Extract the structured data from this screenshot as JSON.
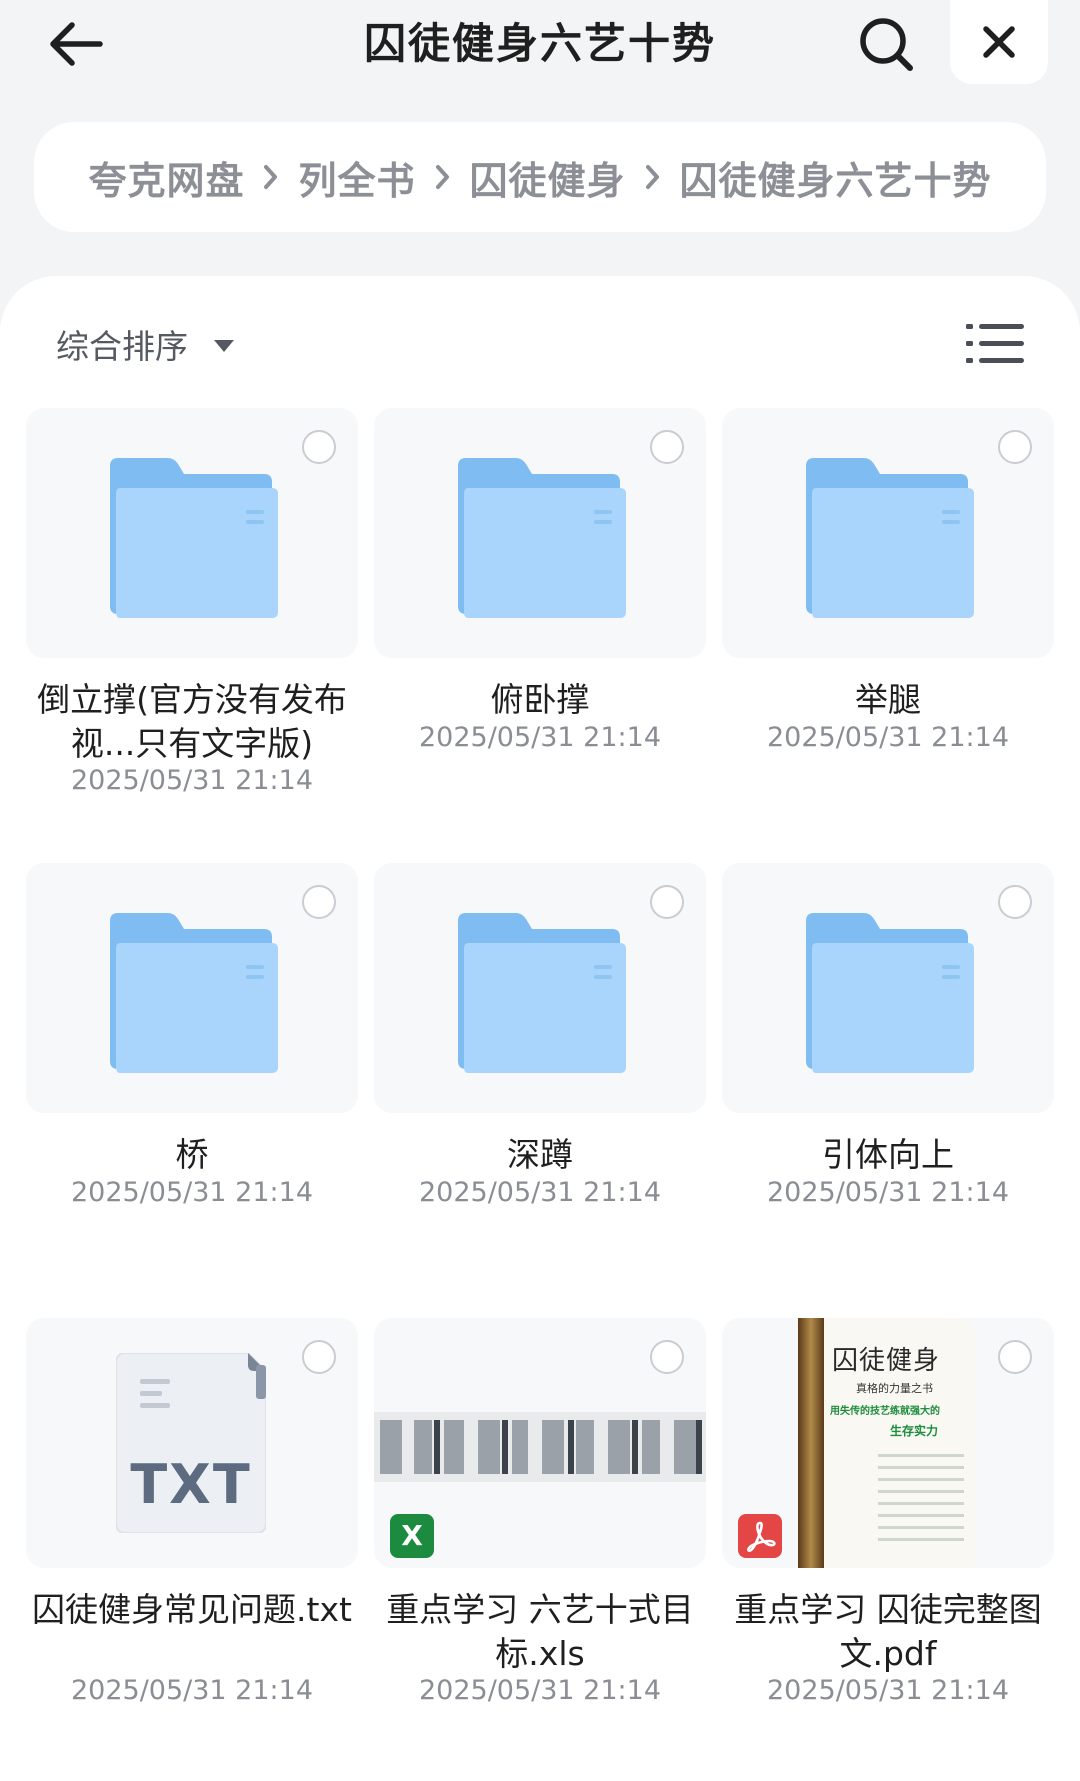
{
  "header": {
    "title": "囚徒健身六艺十势",
    "back_icon": "arrow-left-icon",
    "search_icon": "search-icon",
    "close_icon": "close-icon"
  },
  "breadcrumb": [
    "夸克网盘",
    "列全书",
    "囚徒健身",
    "囚徒健身六艺十势"
  ],
  "toolbar": {
    "sort_label": "综合排序",
    "sort_icon": "caret-down-icon",
    "view_icon": "list-view-icon"
  },
  "colors": {
    "folder": "#7fbcf2",
    "folder_light": "#a9d4fb",
    "xls": "#1d8b3f",
    "pdf": "#e44646"
  },
  "files": [
    {
      "name": "倒立撑(官方没有发布视...只有文字版)",
      "date": "2025/05/31 21:14",
      "type": "folder"
    },
    {
      "name": "俯卧撑",
      "date": "2025/05/31 21:14",
      "type": "folder"
    },
    {
      "name": "举腿",
      "date": "2025/05/31 21:14",
      "type": "folder"
    },
    {
      "name": "桥",
      "date": "2025/05/31 21:14",
      "type": "folder"
    },
    {
      "name": "深蹲",
      "date": "2025/05/31 21:14",
      "type": "folder"
    },
    {
      "name": "引体向上",
      "date": "2025/05/31 21:14",
      "type": "folder"
    },
    {
      "name": "囚徒健身常见问题.txt",
      "date": "2025/05/31 21:14",
      "type": "txt",
      "thumb_label": "TXT"
    },
    {
      "name": "重点学习 六艺十式目标.xls",
      "date": "2025/05/31 21:14",
      "type": "xls",
      "badge": "X"
    },
    {
      "name": "重点学习 囚徒完整图文.pdf",
      "date": "2025/05/31 21:14",
      "type": "pdf",
      "cover": {
        "title": "囚徒健身",
        "subtitle": "真格的力量之书",
        "line1": "用失传的技艺练就强大的",
        "line2": "生存实力"
      }
    }
  ]
}
